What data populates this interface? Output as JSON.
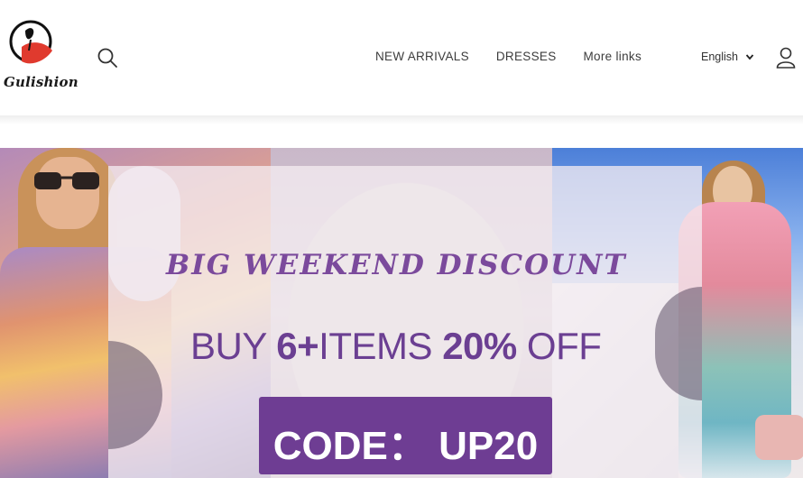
{
  "header": {
    "logo_text": "Gulishion",
    "nav": [
      {
        "label": "NEW ARRIVALS"
      },
      {
        "label": "DRESSES"
      },
      {
        "label": "More links"
      }
    ],
    "language": "English"
  },
  "banner": {
    "headline": "BIG WEEKEND DISCOUNT",
    "offer_prefix": "BUY ",
    "offer_count": "6+",
    "offer_middle": "ITEMS ",
    "offer_percent": "20%",
    "offer_suffix": " OFF",
    "code_text": "CODE： UP20"
  },
  "colors": {
    "accent_purple": "#6e3d93",
    "headline_purple": "#7b4a9c"
  }
}
